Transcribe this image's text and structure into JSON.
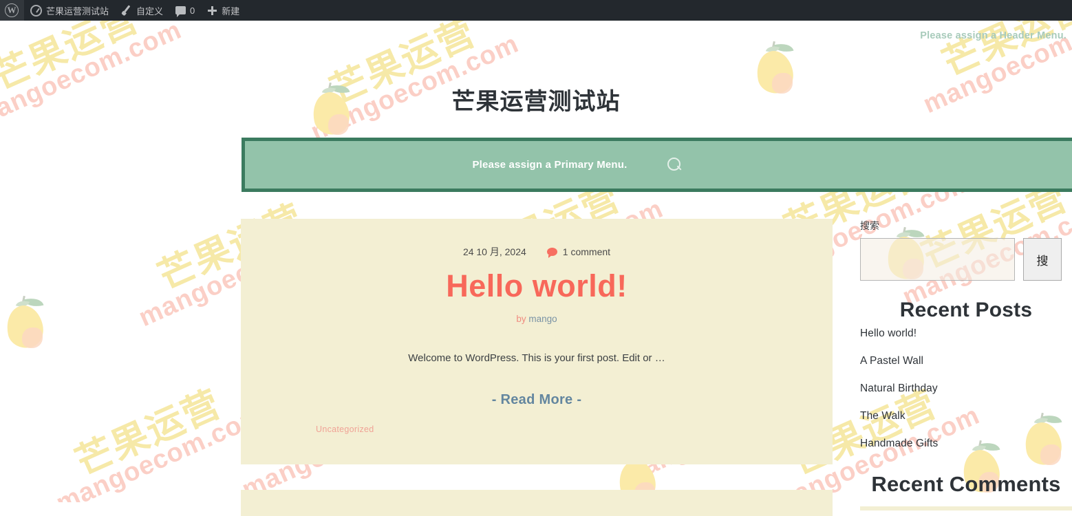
{
  "adminbar": {
    "logo_icon": "wordpress-logo-icon",
    "items": [
      {
        "icon": "dashboard-icon",
        "label": "芒果运营测试站"
      },
      {
        "icon": "customize-brush-icon",
        "label": "自定义"
      },
      {
        "icon": "comment-bubble-icon",
        "label": "0"
      },
      {
        "icon": "plus-icon",
        "label": "新建"
      }
    ]
  },
  "header": {
    "menu_note": "Please assign a Header Menu.",
    "site_title": "芒果运营测试站"
  },
  "primary_menu": {
    "note": "Please assign a Primary Menu.",
    "search_icon": "search-icon",
    "bg_color": "#93c3aa",
    "border_color": "#3b7b5f"
  },
  "post": {
    "date": "24 10 月, 2024",
    "comments_count": "1 comment",
    "comment_icon": "comment-bubble-icon",
    "title": "Hello world!",
    "by_label": "by",
    "author": "mango",
    "excerpt": "Welcome to WordPress. This is your first post. Edit or …",
    "read_more": "- Read More -",
    "category": "Uncategorized",
    "title_color": "#f8685a",
    "card_bg": "#f3efd3"
  },
  "sidebar": {
    "search": {
      "label": "搜索",
      "value": "",
      "placeholder": "",
      "button_label": "搜"
    },
    "recent_posts": {
      "title": "Recent Posts",
      "items": [
        "Hello world!",
        "A Pastel Wall",
        "Natural Birthday",
        "The Walk",
        "Handmade Gifts"
      ]
    },
    "recent_comments": {
      "title": "Recent Comments"
    }
  },
  "watermark": {
    "cn": "芒果运营",
    "en": "mangoecom.com"
  }
}
